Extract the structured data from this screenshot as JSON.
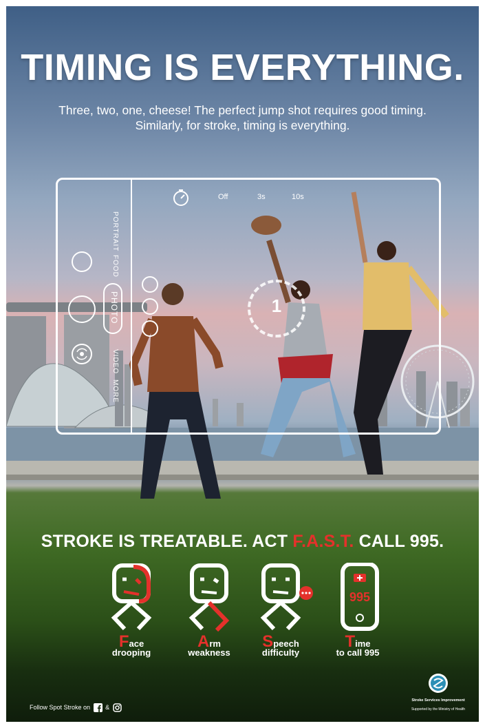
{
  "title": "TIMING IS EVERYTHING.",
  "subtitle": {
    "line1": "Three, two, one, cheese! The perfect jump shot requires good timing.",
    "line2": "Similarly, for stroke, timing is everything."
  },
  "camera_ui": {
    "timer_options": [
      "Off",
      "3s",
      "10s"
    ],
    "modes": [
      "PORTRAIT",
      "FOOD",
      "PHOTO",
      "VIDEO",
      "MORE"
    ],
    "active_mode": "PHOTO",
    "countdown": "1"
  },
  "headline": {
    "part1": "STROKE IS TREATABLE. ACT ",
    "fast": "F.A.S.T.",
    "part2": " CALL 995."
  },
  "fast": [
    {
      "letter": "F",
      "word_rest": "ace",
      "line2": "drooping"
    },
    {
      "letter": "A",
      "word_rest": "rm",
      "line2": "weakness"
    },
    {
      "letter": "S",
      "word_rest": "peech",
      "line2": "difficulty"
    },
    {
      "letter": "T",
      "word_rest": "ime",
      "line2": "to call 995"
    }
  ],
  "phone_number": "995",
  "footer": {
    "follow_text": "Follow Spot Stroke on",
    "amp": "&",
    "org_name": "Stroke Services Improvement",
    "supported_by": "Supported by the Ministry of Health"
  },
  "colors": {
    "accent_red": "#e4312b",
    "text": "#ffffff"
  },
  "icons": [
    "stopwatch-icon",
    "facebook-icon",
    "instagram-icon",
    "face-drooping-icon",
    "arm-weakness-icon",
    "speech-difficulty-icon",
    "phone-icon"
  ]
}
